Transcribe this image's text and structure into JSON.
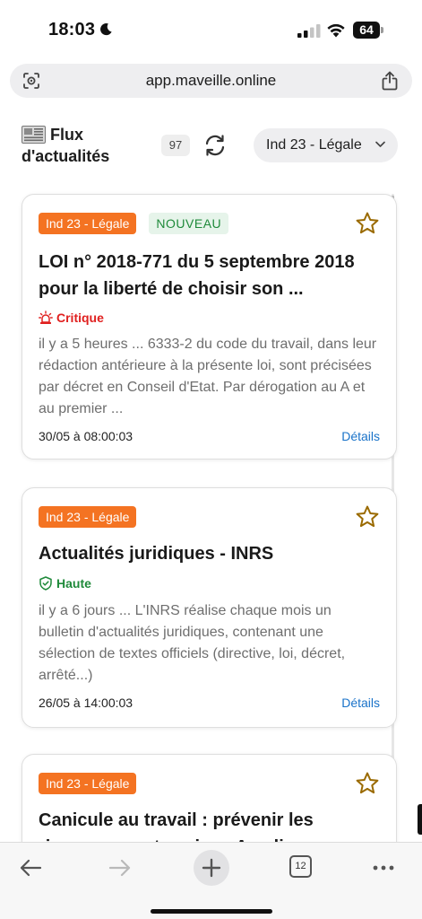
{
  "status_bar": {
    "time": "18:03",
    "battery": "64"
  },
  "address_bar": {
    "url": "app.maveille.online"
  },
  "header": {
    "title": "Flux d'actualités",
    "count": "97",
    "filter_value": "Ind 23 - Légale"
  },
  "feed": {
    "items": [
      {
        "category": "Ind 23 - Légale",
        "new_badge": "NOUVEAU",
        "title": "LOI n° 2018-771 du 5 septembre 2018 pour la liberté de choisir son ...",
        "priority": "Critique",
        "excerpt": "il y a 5 heures ... 6333-2 du code du travail, dans leur rédaction antérieure à la présente loi, sont précisées par décret en Conseil d'Etat. Par dérogation au A et au premier ...",
        "date": "30/05 à 08:00:03",
        "details_label": "Détails"
      },
      {
        "category": "Ind 23 - Légale",
        "title": "Actualités juridiques - INRS",
        "priority": "Haute",
        "excerpt": "il y a 6 jours ... L'INRS réalise chaque mois un bulletin d'actualités juridiques, contenant une sélection de textes officiels (directive, loi, décret, arrêté...)",
        "date": "26/05 à 14:00:03",
        "details_label": "Détails"
      },
      {
        "category": "Ind 23 - Légale",
        "title": "Canicule au travail : prévenir les risques en entreprise - Ameli"
      }
    ]
  },
  "toolbar": {
    "tab_count": "12"
  },
  "colors": {
    "category_tag": "#f47322",
    "new_tag_bg": "#e6f4ea",
    "new_tag_text": "#1f8a3a",
    "critical": "#e0201f",
    "high": "#1f8a3a",
    "link": "#1a73c9",
    "star": "#9a6a00"
  }
}
